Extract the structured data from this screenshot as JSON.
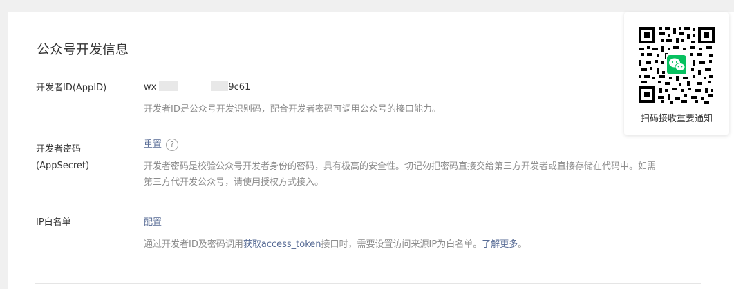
{
  "section": {
    "title": "公众号开发信息"
  },
  "appid": {
    "label": "开发者ID(AppID)",
    "value_prefix": "wx",
    "value_suffix": "9c61",
    "description": "开发者ID是公众号开发识别码，配合开发者密码可调用公众号的接口能力。"
  },
  "secret": {
    "label_line1": "开发者密码",
    "label_line2": "(AppSecret)",
    "reset_link": "重置",
    "help_glyph": "?",
    "description_line1": "开发者密码是校验公众号开发者身份的密码，具有极高的安全性。切记勿把密码直接交给第三方开发者或直接存储在代码中。如需",
    "description_line2": "第三方代开发公众号，请使用授权方式接入。"
  },
  "ip_whitelist": {
    "label": "IP白名单",
    "config_link": "配置",
    "description_before": "通过开发者ID及密码调用",
    "description_link1": "获取access_token",
    "description_middle": "接口时，需要设置访问来源IP为白名单。",
    "description_link2": "了解更多",
    "description_end": "。"
  },
  "qr_panel": {
    "caption": "扫码接收重要通知",
    "icon": "wechat-icon"
  },
  "colors": {
    "link": "#576b95",
    "muted": "#8c8c8c",
    "wechat_green": "#07c160"
  }
}
